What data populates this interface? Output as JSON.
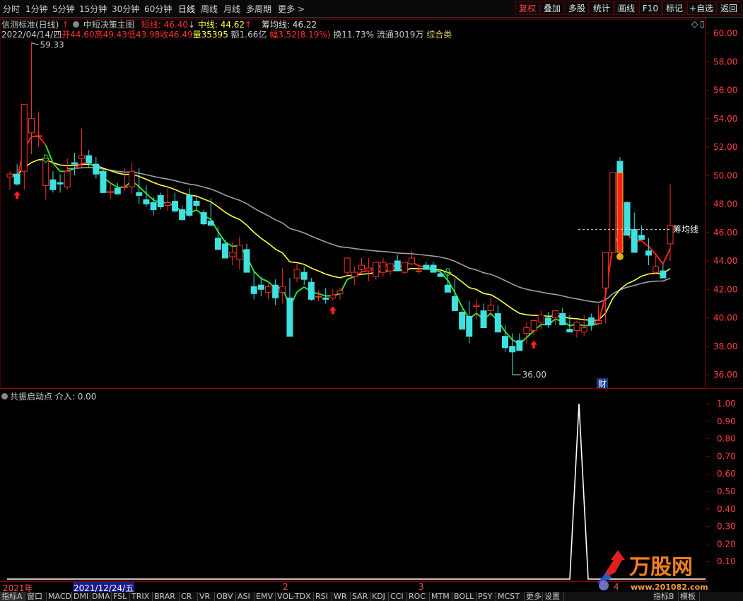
{
  "periods": [
    "分时",
    "1分钟",
    "5分钟",
    "15分钟",
    "30分钟",
    "60分钟",
    "日线",
    "周线",
    "月线",
    "多周期",
    "更多 >"
  ],
  "active_period": "日线",
  "right_buttons": [
    "复权",
    "叠加",
    "多股",
    "统计",
    "画线",
    "F10",
    "标记",
    "+自选",
    "返回"
  ],
  "main": {
    "indicator_name": "信测标准(日线)",
    "strategy": "中短决策主图",
    "short_line_label": "短线: 46.40",
    "mid_line_label": "中线: 44.62",
    "chip_line_label": "筹均线: 46.22",
    "date": "2022/04/14/四",
    "open": "开44.60",
    "high": "高49.43",
    "low": "低43.98",
    "close": "收46.49",
    "volume": "量35395",
    "amount": "额1.66亿",
    "change": "幅3.52(8.19%)",
    "turnover": "换11.73%",
    "float": "流通3019万",
    "category": "综合类",
    "max_annotation": "59.33",
    "min_annotation": "36.00",
    "chip_annotation": "筹均线",
    "finance_marker": "财",
    "price_ticks": [
      "60.00",
      "58.00",
      "56.00",
      "54.00",
      "52.00",
      "50.00",
      "48.00",
      "46.00",
      "44.00",
      "42.00",
      "40.00",
      "38.00",
      "36.00"
    ]
  },
  "sub": {
    "name": "共振启动点",
    "value_label": "介入: 0.00",
    "ticks": [
      "1.00",
      "0.90",
      "0.80",
      "0.70",
      "0.60",
      "0.50",
      "0.40",
      "0.30",
      "0.20",
      "0.10"
    ]
  },
  "time_axis": [
    "2021年",
    "2021/12/24/五",
    "2",
    "3",
    "4"
  ],
  "tabs": [
    "指标A",
    "窗口",
    "MACD",
    "DMI",
    "DMA",
    "FSL",
    "TRIX",
    "BRAR",
    "CR",
    "VR",
    "OBV",
    "ASI",
    "EMV",
    "VOL-TDX",
    "RSI",
    "WR",
    "SAR",
    "KDJ",
    "CCI",
    "ROC",
    "MTM",
    "BOLL",
    "PSY",
    "MCST",
    "更多",
    "设置"
  ],
  "tabs_right": [
    "指标B",
    "模板"
  ],
  "watermark": {
    "brand": "万股网",
    "url": "www.201082.com"
  },
  "colors": {
    "up": "#ff3030",
    "down": "#3fe0e0",
    "short": "#ff2020",
    "mid": "#ffff40",
    "long": "#30e030",
    "chip": "#a0a0a0",
    "grid": "#8a0000"
  },
  "chart_data": {
    "type": "candlestick",
    "price_range": [
      35,
      61
    ],
    "candles": [
      [
        49.9,
        50.3,
        49,
        50.1
      ],
      [
        50.1,
        50.8,
        49.3,
        49.4
      ],
      [
        50.3,
        55,
        49,
        55
      ],
      [
        53,
        59.33,
        51.5,
        54
      ],
      [
        52.8,
        54.5,
        52,
        52.8
      ],
      [
        49.3,
        51.2,
        48.3,
        51.2
      ],
      [
        49.7,
        50.3,
        48.8,
        49
      ],
      [
        49.5,
        50.1,
        48.8,
        49.4
      ],
      [
        49.2,
        51.2,
        49,
        50.3
      ],
      [
        50.9,
        51.6,
        50,
        50.8
      ],
      [
        51.2,
        53.3,
        50.5,
        51.4
      ],
      [
        51.4,
        51.8,
        50.6,
        50.9
      ],
      [
        50.8,
        51.3,
        49.8,
        50.1
      ],
      [
        50.3,
        50.5,
        48.8,
        48.8
      ],
      [
        48.8,
        49.5,
        48.3,
        48.9
      ],
      [
        49.1,
        49.5,
        48.8,
        48.7
      ],
      [
        49.2,
        50.5,
        48.9,
        49.2
      ],
      [
        49.2,
        50.9,
        48.7,
        50.3
      ],
      [
        48.8,
        50.5,
        48,
        48.6
      ],
      [
        48.3,
        49.3,
        47.8,
        48
      ],
      [
        48.1,
        48.5,
        47.2,
        47.6
      ],
      [
        48.6,
        48.8,
        47.6,
        47.8
      ],
      [
        47.9,
        49.1,
        47.5,
        48.1
      ],
      [
        48.2,
        48.8,
        47.4,
        47.5
      ],
      [
        47.6,
        47.9,
        46.8,
        46.9
      ],
      [
        48.6,
        49.1,
        47.1,
        47.2
      ],
      [
        48.2,
        48.6,
        47.6,
        47.9
      ],
      [
        47.4,
        47.6,
        46.5,
        46.6
      ],
      [
        46.8,
        48.4,
        46.5,
        46.5
      ],
      [
        45.6,
        46.4,
        44.9,
        44.8
      ],
      [
        45.2,
        45.5,
        44.6,
        44.2
      ],
      [
        44.3,
        45.3,
        43.7,
        44.6
      ],
      [
        44.1,
        45.7,
        43.4,
        45.1
      ],
      [
        44.8,
        45.2,
        43.4,
        43.2
      ],
      [
        42.2,
        43.2,
        41.3,
        41.7
      ],
      [
        42.3,
        42.9,
        41.5,
        42
      ],
      [
        41.8,
        42.4,
        41.3,
        42.2
      ],
      [
        42.3,
        42.7,
        40.9,
        41.4
      ],
      [
        41.8,
        43.5,
        41,
        42.2
      ],
      [
        41.4,
        42.8,
        39.3,
        38.7
      ],
      [
        42.8,
        43.8,
        42.5,
        43.4
      ],
      [
        43.2,
        43.6,
        42.3,
        42.7
      ],
      [
        42.5,
        42.8,
        41.2,
        41.3
      ],
      [
        41.5,
        41.9,
        41.2,
        41.5
      ],
      [
        41.4,
        42.1,
        41,
        41.3
      ],
      [
        41.4,
        42,
        41.2,
        41.6
      ],
      [
        41.7,
        42.1,
        41.3,
        41.9
      ],
      [
        43.2,
        43.9,
        43,
        44.2
      ],
      [
        42.9,
        43.6,
        42.3,
        43.2
      ],
      [
        43.4,
        44.2,
        43.2,
        43.7
      ],
      [
        43.3,
        44.2,
        42.6,
        43.5
      ],
      [
        42.9,
        43.9,
        42.7,
        43.9
      ],
      [
        43.2,
        44.2,
        42.9,
        43.9
      ],
      [
        43.3,
        43.7,
        43,
        43.8
      ],
      [
        44,
        44.4,
        43.3,
        43.3
      ],
      [
        43.2,
        43.8,
        43.1,
        43.9
      ],
      [
        43.8,
        44.7,
        43.7,
        44.2
      ],
      [
        43.3,
        43.7,
        43.1,
        43.3
      ],
      [
        43.7,
        43.9,
        43.6,
        43.4
      ],
      [
        43.7,
        43.9,
        43.3,
        43.2
      ],
      [
        43.1,
        43.3,
        42.9,
        42.9
      ],
      [
        42.3,
        43.2,
        41.8,
        41.8
      ],
      [
        41.5,
        42.8,
        40.8,
        40.5
      ],
      [
        40.4,
        40.6,
        39.8,
        39.2
      ],
      [
        40.1,
        41.2,
        38.2,
        38.7
      ],
      [
        40.8,
        41.3,
        39.9,
        40.9
      ],
      [
        40.5,
        41,
        39.6,
        39.3
      ],
      [
        40.5,
        41.4,
        40.1,
        40.9
      ],
      [
        40.3,
        40.9,
        39.1,
        39
      ],
      [
        38.7,
        39.5,
        37.6,
        37.9
      ],
      [
        38,
        38.9,
        36,
        37.6
      ],
      [
        38.4,
        38.9,
        37.9,
        37.7
      ],
      [
        38.9,
        39.7,
        38.2,
        39.3
      ],
      [
        39.1,
        39.9,
        38.8,
        39.8
      ],
      [
        39.7,
        40.5,
        39.2,
        40.2
      ],
      [
        40,
        40.4,
        39.3,
        39.5
      ],
      [
        40,
        40.5,
        39.5,
        40.5
      ],
      [
        40.3,
        40.7,
        39.8,
        39.5
      ],
      [
        39.2,
        40.2,
        39,
        39
      ],
      [
        39.1,
        39.8,
        38.6,
        39.7
      ],
      [
        39,
        40.2,
        38.7,
        39.3
      ],
      [
        40,
        40.3,
        39.1,
        39.5
      ],
      [
        39.6,
        40.9,
        39.5,
        39.8
      ],
      [
        42.1,
        42.5,
        39.6,
        44.6
      ],
      [
        44.6,
        50.2,
        44.6,
        50.2
      ],
      [
        51,
        51.3,
        47.2,
        47.3
      ],
      [
        48.1,
        48.2,
        45.8,
        45.8
      ],
      [
        46.2,
        47.4,
        44.6,
        44.6
      ],
      [
        45.8,
        46.5,
        45.5,
        45.5
      ],
      [
        44.7,
        45.6,
        43.7,
        44.4
      ],
      [
        43.2,
        44.5,
        43.1,
        43.6
      ],
      [
        43.3,
        43.8,
        43,
        42.8
      ],
      [
        45.2,
        49.43,
        43.98,
        46.49
      ]
    ],
    "series": [
      {
        "name": "短线",
        "values": []
      },
      {
        "name": "中线",
        "values": []
      },
      {
        "name": "筹均线",
        "values": []
      }
    ]
  }
}
